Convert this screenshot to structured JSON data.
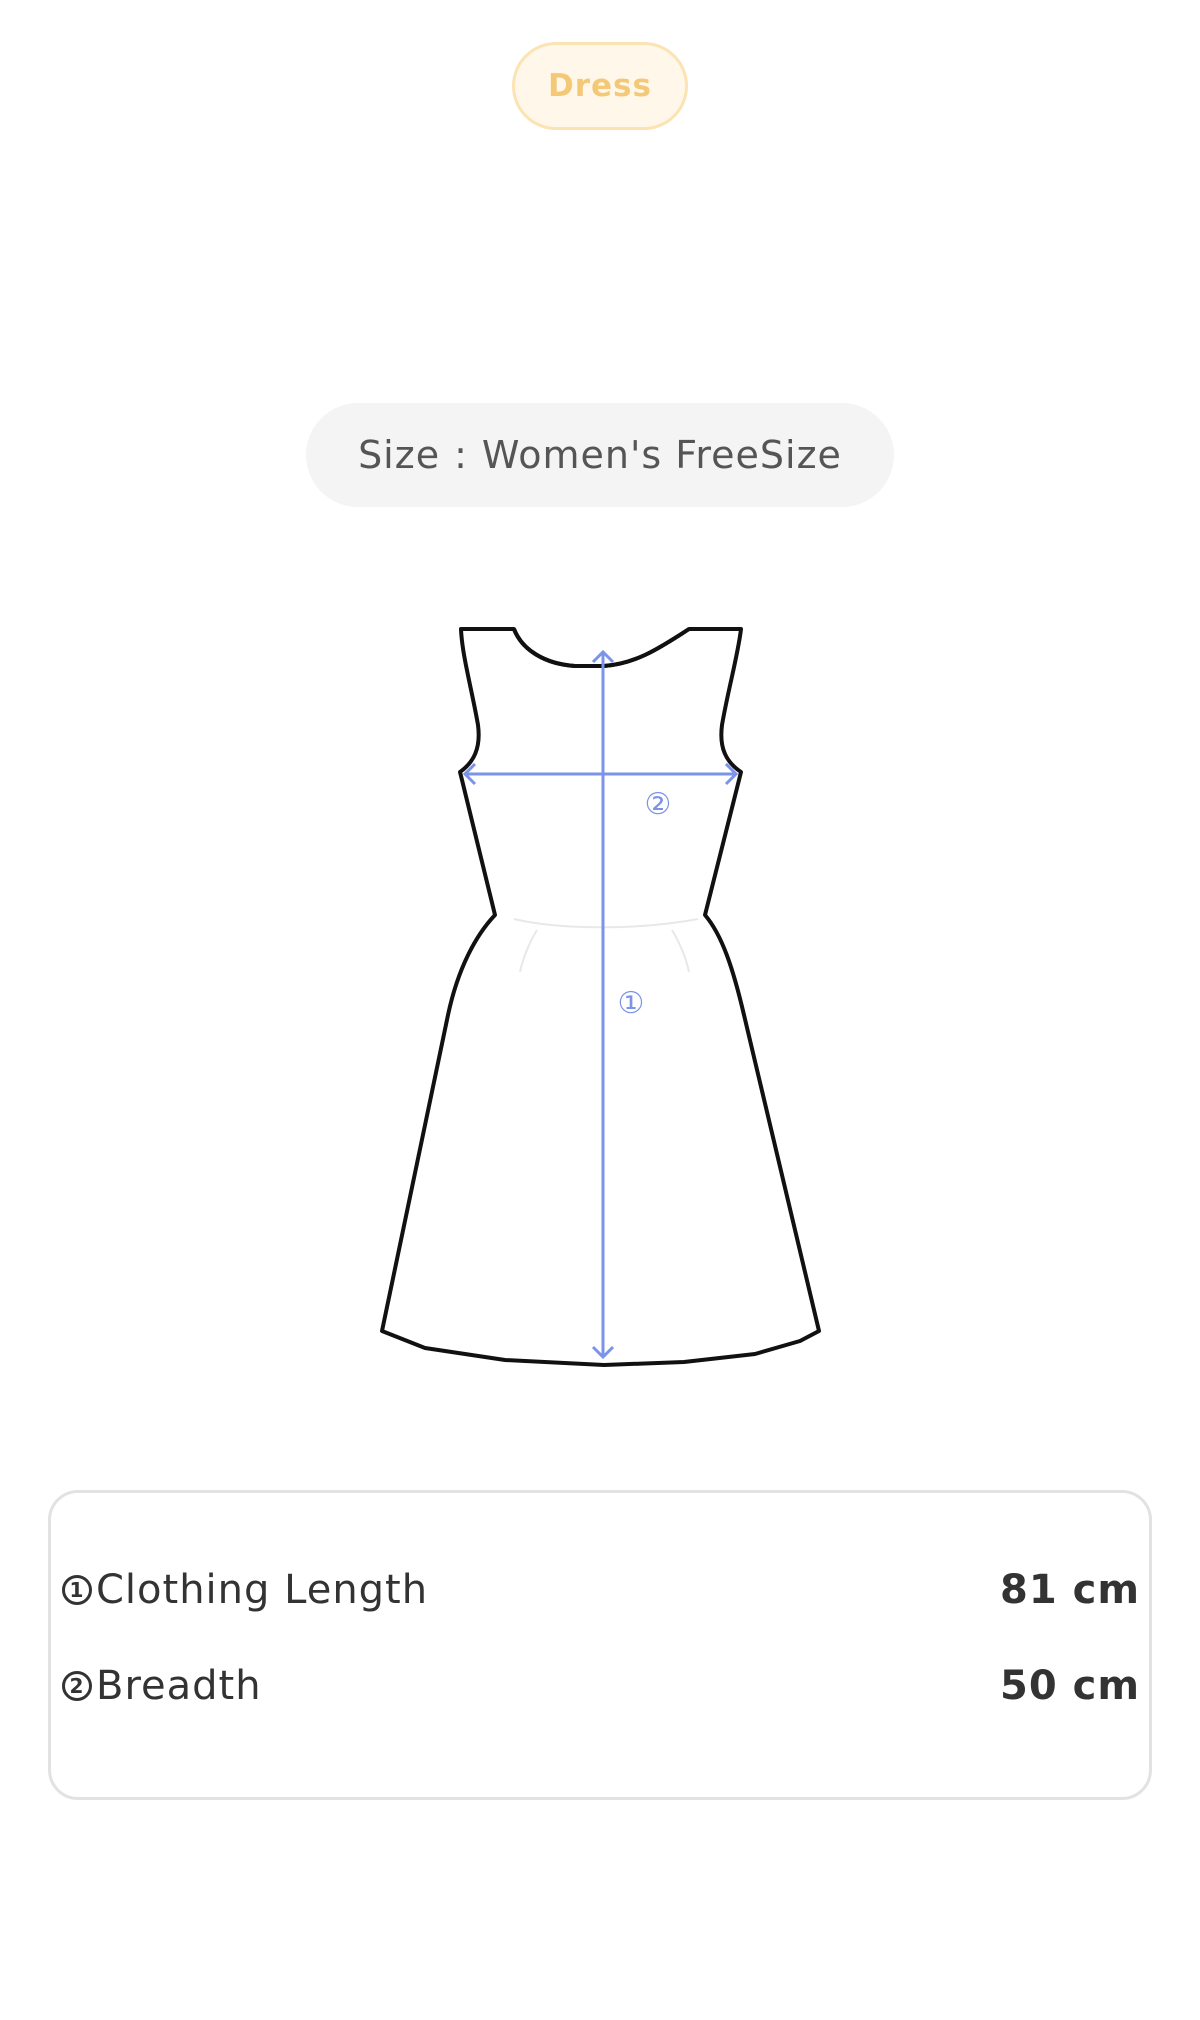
{
  "category": {
    "label": "Dress"
  },
  "size": {
    "prefix": "Size",
    "separator": ":",
    "value": "Women's FreeSize"
  },
  "diagram": {
    "icon": "sleeveless-dress-icon",
    "line_color": "#7b93e8",
    "markers": [
      {
        "id": "1",
        "text": "①",
        "measure": "Clothing Length"
      },
      {
        "id": "2",
        "text": "②",
        "measure": "Breadth"
      }
    ]
  },
  "measurements": [
    {
      "marker": "1",
      "label": "Clothing Length",
      "value": "81 cm"
    },
    {
      "marker": "2",
      "label": "Breadth",
      "value": "50 cm"
    }
  ],
  "colors": {
    "category_text": "#f3c876",
    "category_border": "#fbe3b2",
    "size_bg": "#f4f4f4",
    "card_border": "#e2e2e2"
  }
}
